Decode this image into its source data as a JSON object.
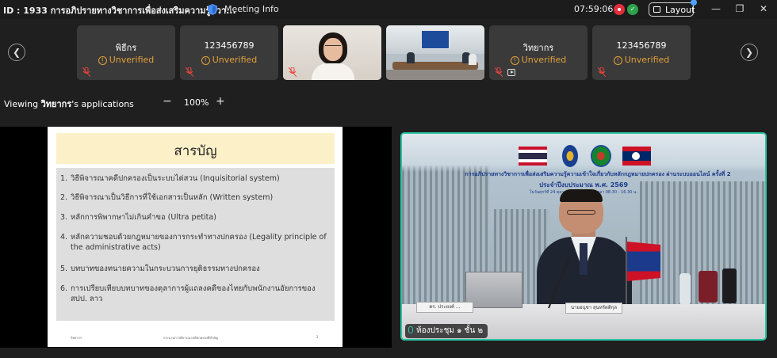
{
  "titlebar": {
    "meeting_id": "ID : 1933  การอภิปรายทางวิชาการเพื่อส่งเสริมความรู้ควา...",
    "meeting_info": "Meeting Info",
    "time": "07:59:06",
    "layout_label": "Layout",
    "recording_color": "#e02e3a",
    "secure_color": "#2da14b"
  },
  "participants": [
    {
      "name": "พิธีกร",
      "status": "Unverified",
      "type": "name",
      "camera_icon": false
    },
    {
      "name": "123456789",
      "status": "Unverified",
      "type": "name",
      "camera_icon": false
    },
    {
      "name": "",
      "status": "",
      "type": "video-person",
      "camera_icon": false
    },
    {
      "name": "",
      "status": "",
      "type": "video-room",
      "camera_icon": false
    },
    {
      "name": "วิทยากร",
      "status": "Unverified",
      "type": "name",
      "camera_icon": true
    },
    {
      "name": "123456789",
      "status": "Unverified",
      "type": "name",
      "camera_icon": false
    }
  ],
  "viewing": {
    "prefix": "Viewing ",
    "name": "วิทยากร",
    "suffix": "'s applications",
    "zoom": "100%",
    "zoom_minus": "−",
    "zoom_plus": "+"
  },
  "slide": {
    "title": "สารบัญ",
    "items": [
      {
        "num": "1.",
        "text": "วิธีพิจารณาคดีปกครองเป็นระบบไต่สวน (Inquisitorial system)"
      },
      {
        "num": "2.",
        "text": "วิธีพิจารณาเป็นวิธีการที่ใช้เอกสารเป็นหลัก (Written system)"
      },
      {
        "num": "3.",
        "text": "หลักการพิพากษาไม่เกินคำขอ (Ultra petita)"
      },
      {
        "num": "4.",
        "text": "หลักความชอบด้วยกฎหมายของการกระทำทางปกครอง (Legality principle of the administrative acts)"
      },
      {
        "num": "5.",
        "text": "บทบาทของทนายความในกระบวนการยุติธรรมทางปกครอง"
      },
      {
        "num": "6.",
        "text": "การเปรียบเทียบบทบาทของตุลาการผู้แถลงคดีของไทยกับพนักงานอัยการของ สปป. ลาว"
      }
    ],
    "footer_left": "วิทยากร",
    "footer_center": "กระบวนการพิจารณาคดีปกครองที่สำคัญ",
    "footer_right": "2"
  },
  "speaker": {
    "banner_line1": "การอภิปรายทางวิชาการเพื่อส่งเสริมความรู้ความเข้าใจเกี่ยวกับหลักกฎหมายปกครอง ผ่านระบบออนไลน์ ครั้งที่ 2",
    "banner_line2": "ประจำปีงบประมาณ พ.ศ. 2569",
    "banner_line3": "ในวันศุกร์ที่ 24 ตุลาคม 2568 (2569) เวลา 08.30 - 16.30 น.",
    "nameplate_left": "ดร. ประยงค์ ...",
    "nameplate_right": "นายอนุชา สุนทรัตติกุล",
    "room_label": "ห้องประชุม ๑ ชั้น ๒",
    "border_color": "#2bc4a4"
  }
}
